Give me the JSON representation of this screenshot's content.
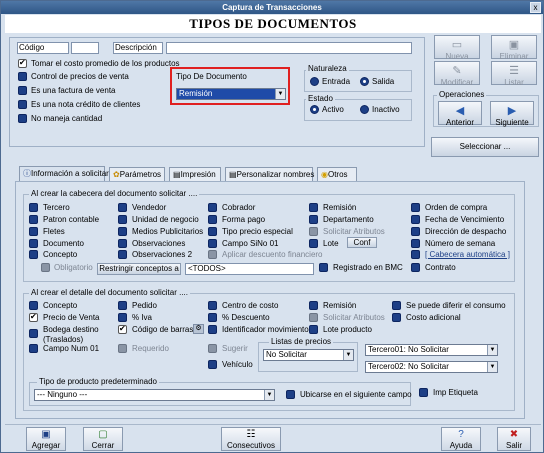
{
  "window": {
    "title": "Captura de Transacciones",
    "close": "x"
  },
  "header": {
    "title": "TIPOS DE DOCUMENTOS"
  },
  "top": {
    "codigo_label": "Código",
    "descripcion_label": "Descripción",
    "tomar_costo": "Tomar el costo promedio de los productos",
    "control_precios": "Control de precios de venta",
    "es_factura": "Es una factura de venta",
    "es_nota": "Es una nota crédito de clientes",
    "no_cantidad": "No maneja cantidad",
    "tipo_doc_label": "Tipo De Documento",
    "tipo_doc_value": "Remisión",
    "naturaleza": "Naturaleza",
    "entrada": "Entrada",
    "salida": "Salida",
    "estado": "Estado",
    "activo": "Activo",
    "inactivo": "Inactivo"
  },
  "right_buttons": {
    "nueva": "Nueva",
    "eliminar": "Eliminar",
    "modificar": "Modificar",
    "listar": "Listar",
    "operaciones": "Operaciones",
    "anterior": "Anterior",
    "siguiente": "Siguiente",
    "seleccionar": "Seleccionar ..."
  },
  "tabs": [
    "Información a solicitar",
    "Parámetros",
    "Impresión",
    "Personalizar nombres",
    "Otros"
  ],
  "cabecera": {
    "title": "Al crear la cabecera del documento solicitar ....",
    "col1": [
      "Tercero",
      "Patron contable",
      "Fletes",
      "Documento",
      "Concepto"
    ],
    "col2": [
      "Vendedor",
      "Unidad de negocio",
      "Medios Publicitarios",
      "Observaciones",
      "Observaciones 2"
    ],
    "col3": [
      "Cobrador",
      "Forma pago",
      "Tipo precio especial",
      "Campo SiNo 01",
      "Aplicar descuento financiero"
    ],
    "col4": [
      "Remisión",
      "Departamento",
      "Solicitar Atributos",
      "Lote"
    ],
    "col5": [
      "Orden de compra",
      "Fecha de Vencimiento",
      "Dirección de despacho",
      "Número de semana",
      "[ Cabecera automática ]"
    ],
    "conf": "Conf",
    "obligatorio": "Obligatorio",
    "restringir": "Restringir conceptos a",
    "todos": "<TODOS>",
    "registrado": "Registrado en BMC",
    "contrato": "Contrato"
  },
  "detalle": {
    "title": "Al crear  el detalle del documento solicitar ....",
    "col1": [
      "Concepto",
      "Precio de Venta",
      "Bodega destino (Traslados)",
      "Campo Num 01"
    ],
    "col2": [
      "Pedido",
      "% Iva",
      "Código de barras",
      "Requerido"
    ],
    "col3": [
      "Centro de costo",
      "% Descuento",
      "Identificador movimiento",
      "Sugerir",
      "Vehículo"
    ],
    "col4": [
      "Remisión",
      "Solicitar Atributos",
      "Lote producto"
    ],
    "col5": [
      "Se puede diferir el consumo",
      "Costo adicional"
    ],
    "listas_title": "Listas de precios",
    "listas_value": "No Solicitar",
    "tercero01": "Tercero01: No Solicitar",
    "tercero02": "Tercero02: No Solicitar",
    "tipo_producto_title": "Tipo de producto predeterminado",
    "tipo_producto_value": "--- Ninguno ---",
    "ubicarse": "Ubicarse en el siguiente campo",
    "imp_etiqueta": "Imp Etiqueta"
  },
  "bottom": {
    "agregar": "Agregar",
    "cerrar": "Cerrar",
    "consecutivos": "Consecutivos",
    "ayuda": "Ayuda",
    "salir": "Salir"
  },
  "colors": {
    "title_bar": "#2f5686",
    "highlight": "#1f4ba8",
    "red_box": "#e02020"
  }
}
